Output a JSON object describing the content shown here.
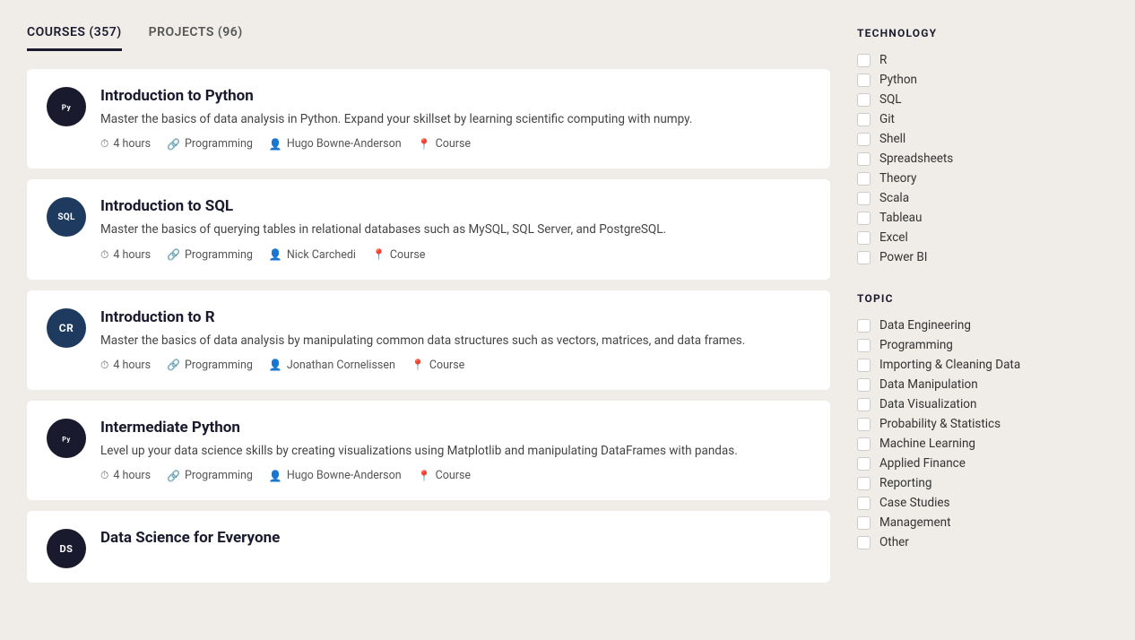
{
  "tabs": [
    {
      "id": "courses",
      "label": "COURSES (357)",
      "active": true
    },
    {
      "id": "projects",
      "label": "PROJECTS (96)",
      "active": false
    }
  ],
  "courses": [
    {
      "id": "intro-python",
      "iconText": "🐍",
      "iconClass": "python",
      "title": "Introduction to Python",
      "description": "Master the basics of data analysis in Python. Expand your skillset by learning scientific computing with numpy.",
      "hours": "4 hours",
      "topic": "Programming",
      "instructor": "Hugo Bowne-Anderson",
      "type": "Course"
    },
    {
      "id": "intro-sql",
      "iconText": "SQL",
      "iconClass": "sql",
      "title": "Introduction to SQL",
      "description": "Master the basics of querying tables in relational databases such as MySQL, SQL Server, and PostgreSQL.",
      "hours": "4 hours",
      "topic": "Programming",
      "instructor": "Nick Carchedi",
      "type": "Course"
    },
    {
      "id": "intro-r",
      "iconText": "CR",
      "iconClass": "r",
      "title": "Introduction to R",
      "description": "Master the basics of data analysis by manipulating common data structures such as vectors, matrices, and data frames.",
      "hours": "4 hours",
      "topic": "Programming",
      "instructor": "Jonathan Cornelissen",
      "type": "Course"
    },
    {
      "id": "intermediate-python",
      "iconText": "🐍",
      "iconClass": "intpython",
      "title": "Intermediate Python",
      "description": "Level up your data science skills by creating visualizations using Matplotlib and manipulating DataFrames with pandas.",
      "hours": "4 hours",
      "topic": "Programming",
      "instructor": "Hugo Bowne-Anderson",
      "type": "Course"
    },
    {
      "id": "data-science-everyone",
      "iconText": "DS",
      "iconClass": "datasci",
      "title": "Data Science for Everyone",
      "description": "",
      "hours": "",
      "topic": "",
      "instructor": "",
      "type": ""
    }
  ],
  "sidebar": {
    "technology_title": "TECHNOLOGY",
    "technology_items": [
      "R",
      "Python",
      "SQL",
      "Git",
      "Shell",
      "Spreadsheets",
      "Theory",
      "Scala",
      "Tableau",
      "Excel",
      "Power BI"
    ],
    "topic_title": "TOPIC",
    "topic_items": [
      "Data Engineering",
      "Programming",
      "Importing & Cleaning Data",
      "Data Manipulation",
      "Data Visualization",
      "Probability & Statistics",
      "Machine Learning",
      "Applied Finance",
      "Reporting",
      "Case Studies",
      "Management",
      "Other"
    ]
  }
}
